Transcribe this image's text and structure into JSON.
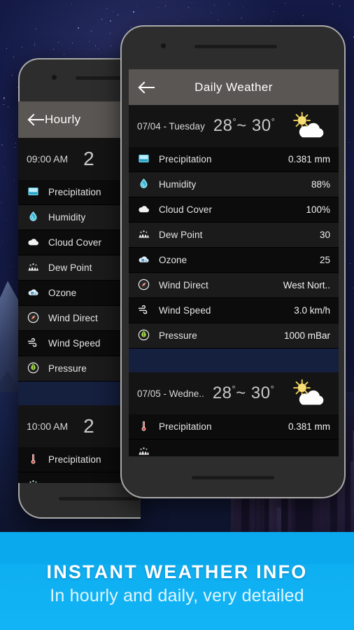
{
  "banner": {
    "title": "INSTANT WEATHER INFO",
    "subtitle": "In hourly and daily, very detailed",
    "bg_color": "#0fb0f2"
  },
  "back_phone": {
    "appbar": {
      "back_icon": "back-arrow-icon",
      "title": "Hourly"
    },
    "hours": [
      {
        "time": "09:00 AM",
        "temp": "2",
        "rows": [
          {
            "icon": "precipitation-icon",
            "label": "Precipitation",
            "value": ""
          },
          {
            "icon": "humidity-icon",
            "label": "Humidity",
            "value": ""
          },
          {
            "icon": "cloud-cover-icon",
            "label": "Cloud Cover",
            "value": ""
          },
          {
            "icon": "dew-point-icon",
            "label": "Dew Point",
            "value": ""
          },
          {
            "icon": "ozone-icon",
            "label": "Ozone",
            "value": ""
          },
          {
            "icon": "wind-direct-icon",
            "label": "Wind Direct",
            "value": ""
          },
          {
            "icon": "wind-speed-icon",
            "label": "Wind Speed",
            "value": ""
          },
          {
            "icon": "pressure-icon",
            "label": "Pressure",
            "value": ""
          }
        ]
      },
      {
        "time": "10:00 AM",
        "temp": "2",
        "rows": [
          {
            "icon": "temperature-icon",
            "label": "Precipitation",
            "value": ""
          }
        ]
      }
    ]
  },
  "front_phone": {
    "appbar": {
      "back_icon": "back-arrow-icon",
      "title": "Daily Weather"
    },
    "days": [
      {
        "date": "07/04 - Tuesday",
        "temp_low": "28",
        "temp_high": "30",
        "temp_sep": "~",
        "degree": "°",
        "weather_icon": "sun-behind-cloud-icon",
        "rows": [
          {
            "icon": "precipitation-icon",
            "label": "Precipitation",
            "value": "0.381 mm"
          },
          {
            "icon": "humidity-icon",
            "label": "Humidity",
            "value": "88%"
          },
          {
            "icon": "cloud-cover-icon",
            "label": "Cloud Cover",
            "value": "100%"
          },
          {
            "icon": "dew-point-icon",
            "label": "Dew Point",
            "value": "30"
          },
          {
            "icon": "ozone-icon",
            "label": "Ozone",
            "value": "25"
          },
          {
            "icon": "wind-direct-icon",
            "label": "Wind Direct",
            "value": "West Nort.."
          },
          {
            "icon": "wind-speed-icon",
            "label": "Wind Speed",
            "value": "3.0 km/h"
          },
          {
            "icon": "pressure-icon",
            "label": "Pressure",
            "value": "1000 mBar"
          }
        ]
      },
      {
        "date": "07/05 - Wedne..",
        "temp_low": "28",
        "temp_high": "30",
        "temp_sep": "~",
        "degree": "°",
        "weather_icon": "sun-behind-cloud-icon",
        "rows": [
          {
            "icon": "temperature-icon",
            "label": "Precipitation",
            "value": "0.381 mm"
          }
        ]
      }
    ]
  }
}
